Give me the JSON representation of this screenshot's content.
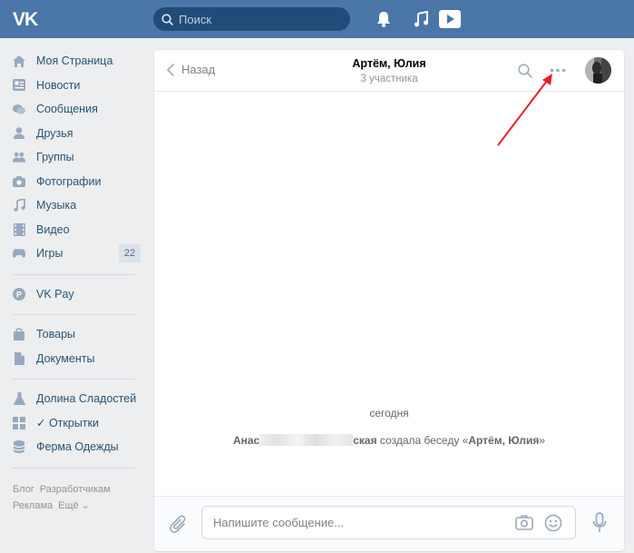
{
  "header": {
    "logo_text": "VK",
    "search_placeholder": "Поиск",
    "icons": [
      "search-icon",
      "bell-icon",
      "music-note-icon",
      "play-icon"
    ],
    "brand_color": "#4a76a8"
  },
  "sidebar": {
    "items": [
      {
        "label": "Моя Страница",
        "icon": "home-icon"
      },
      {
        "label": "Новости",
        "icon": "newspaper-icon"
      },
      {
        "label": "Сообщения",
        "icon": "chat-bubbles-icon"
      },
      {
        "label": "Друзья",
        "icon": "user-icon"
      },
      {
        "label": "Группы",
        "icon": "group-icon"
      },
      {
        "label": "Фотографии",
        "icon": "camera-icon"
      },
      {
        "label": "Музыка",
        "icon": "music-note-icon"
      },
      {
        "label": "Видео",
        "icon": "film-icon"
      },
      {
        "label": "Игры",
        "icon": "gamepad-icon",
        "badge": "22"
      }
    ],
    "items2": [
      {
        "label": "VK Pay",
        "icon": "vkpay-icon"
      }
    ],
    "items3": [
      {
        "label": "Товары",
        "icon": "shopping-bag-icon"
      },
      {
        "label": "Документы",
        "icon": "document-icon"
      }
    ],
    "items4": [
      {
        "label": "Долина Сладостей",
        "icon": "flask-icon"
      },
      {
        "label": "✓ Открытки",
        "icon": "grid-icon"
      },
      {
        "label": "Ферма Одежды",
        "icon": "database-icon"
      }
    ],
    "footer": {
      "blog": "Блог",
      "developers": "Разработчикам",
      "ads": "Реклама",
      "more": "Ещё ⌄"
    }
  },
  "chat": {
    "back_label": "Назад",
    "title": "Артём, Юлия",
    "subtitle": "3 участника",
    "date_separator": "сегодня",
    "system_message": {
      "name_start": "Анас",
      "name_end": "ская",
      "action": " создала беседу «",
      "chat_name": "Артём, Юлия",
      "close": "»"
    },
    "composer_placeholder": "Напишите сообщение...",
    "link_color": "#285473",
    "annotation_color": "#e8212b"
  }
}
